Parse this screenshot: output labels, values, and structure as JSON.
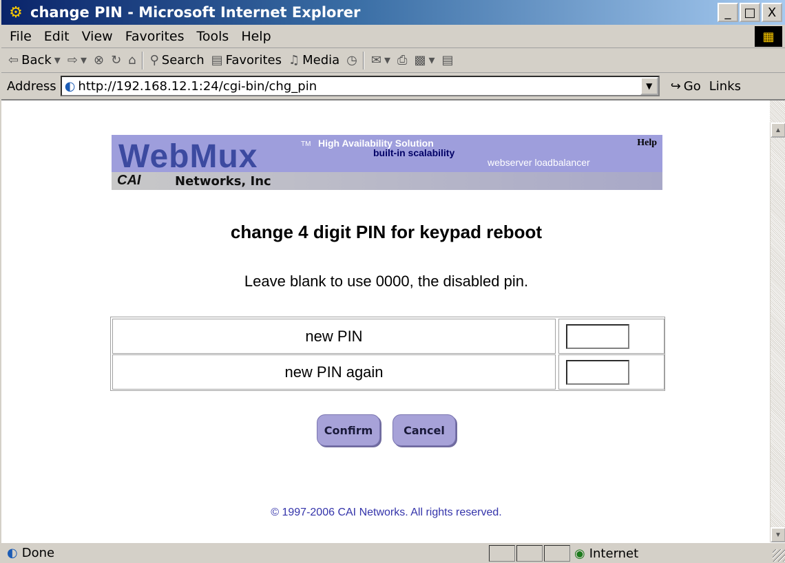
{
  "window": {
    "title": "change PIN - Microsoft Internet Explorer",
    "minimize": "_",
    "maximize": "□",
    "close": "X"
  },
  "menu": {
    "items": [
      "File",
      "Edit",
      "View",
      "Favorites",
      "Tools",
      "Help"
    ]
  },
  "toolbar": {
    "back": "Back",
    "search": "Search",
    "favorites": "Favorites",
    "media": "Media"
  },
  "address": {
    "label": "Address",
    "url": "http://192.168.12.1:24/cgi-bin/chg_pin",
    "go": "Go",
    "links": "Links"
  },
  "banner": {
    "logo": "WebMux",
    "tm": "TM",
    "tagline_1": "High Availability Solution",
    "tagline_2": "built-in scalability",
    "tagline_3": "webserver loadbalancer",
    "help": "Help",
    "company_mark": "CAI",
    "company_name": "Networks, Inc"
  },
  "page": {
    "heading": "change 4 digit PIN for keypad reboot",
    "hint": "Leave blank to use 0000, the disabled pin.",
    "fields": [
      {
        "label": "new PIN",
        "value": ""
      },
      {
        "label": "new PIN again",
        "value": ""
      }
    ],
    "confirm_label": "Confirm",
    "cancel_label": "Cancel",
    "copyright": "© 1997-2006 CAI Networks. All rights reserved."
  },
  "status": {
    "text": "Done",
    "zone": "Internet"
  },
  "colors": {
    "banner": "#9e9edc",
    "button": "#a7a2d8",
    "link": "#3333aa"
  }
}
